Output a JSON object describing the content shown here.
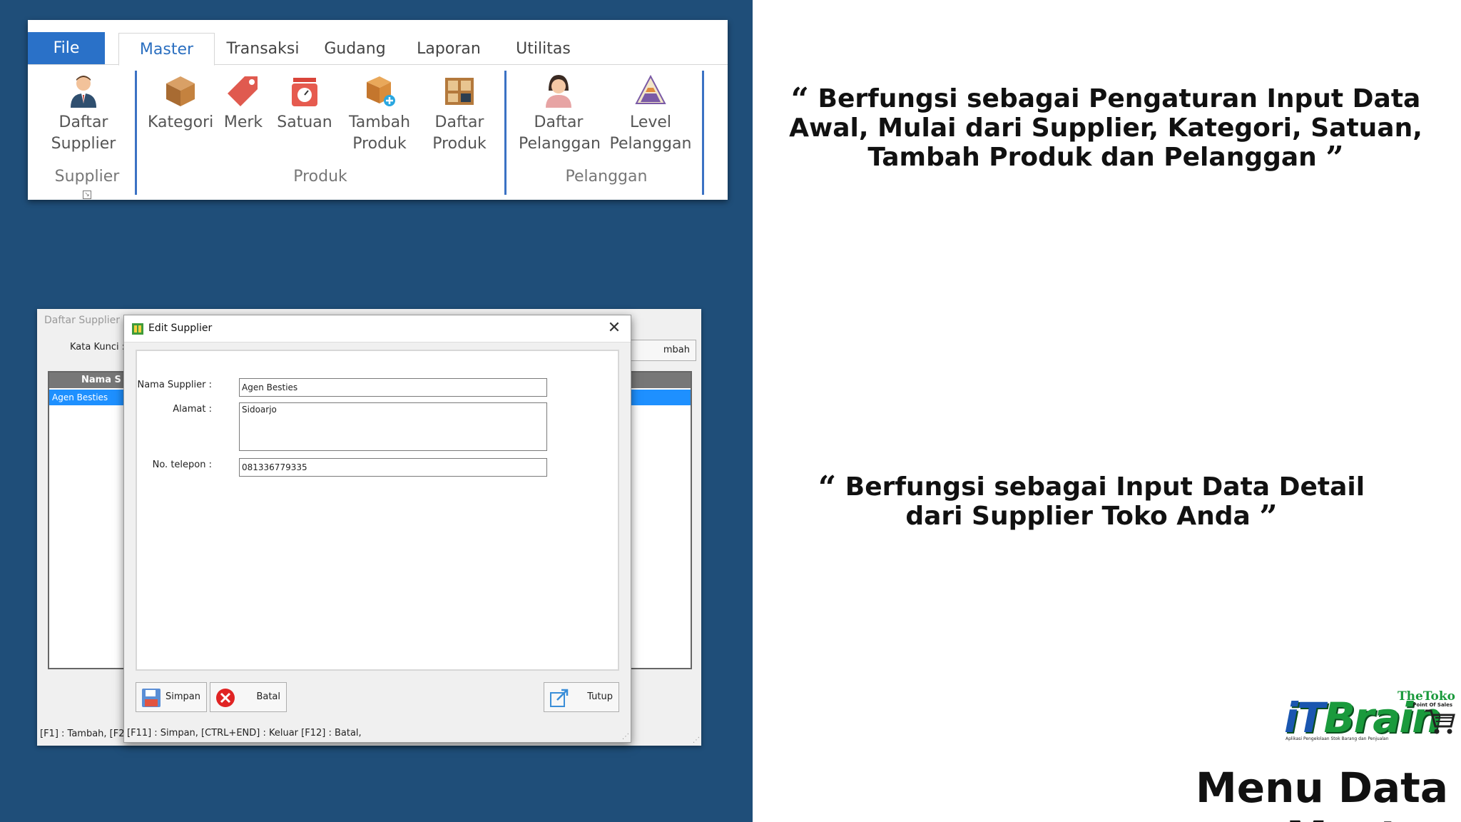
{
  "ribbon": {
    "tabs": [
      "File",
      "Master",
      "Transaksi",
      "Gudang",
      "Laporan",
      "Utilitas"
    ],
    "buttons": {
      "daftar_supplier": "Daftar\nSupplier",
      "kategori": "Kategori",
      "merk": "Merk",
      "satuan": "Satuan",
      "tambah_produk": "Tambah\nProduk",
      "daftar_produk": "Daftar\nProduk",
      "daftar_pelanggan": "Daftar\nPelanggan",
      "level_pelanggan": "Level\nPelanggan"
    },
    "groups": {
      "supplier": "Supplier",
      "produk": "Produk",
      "pelanggan": "Pelanggan"
    }
  },
  "daftar_supplier": {
    "title": "Daftar Supplier",
    "kata_kunci_label": "Kata Kunci :",
    "tambah_button": "mbah",
    "column_header": "Nama S",
    "rows": [
      "Agen Besties"
    ],
    "status": "[F1] : Tambah,    [F2"
  },
  "edit_supplier": {
    "title": "Edit Supplier",
    "close": "✕",
    "fields": {
      "nama_label": "Nama Supplier :",
      "nama_value": "Agen Besties",
      "alamat_label": "Alamat :",
      "alamat_value": "Sidoarjo",
      "telepon_label": "No. telepon :",
      "telepon_value": "081336779335"
    },
    "buttons": {
      "simpan": "Simpan",
      "batal": "Batal",
      "tutup": "Tutup"
    },
    "status": "[F11] : Simpan,    [CTRL+END] : Keluar    [F12] : Batal,"
  },
  "captions": {
    "caption1": "Berfungsi sebagai Pengaturan Input Data Awal, Mulai dari Supplier, Kategori, Satuan, Tambah Produk dan Pelanggan",
    "caption2": "Berfungsi sebagai Input Data Detail dari Supplier Toko Anda",
    "open_quote": "“",
    "close_quote": "”"
  },
  "slide_title": "Menu Data Master",
  "logo": {
    "it": "iT",
    "brain": "Brain",
    "thetoko": "TheToko",
    "pos": "Point Of Sales",
    "tagline": "Aplikasi Pengelolaan Stok Barang dan Penjualan"
  },
  "colors": {
    "left_background": "#1f4e79",
    "ribbon_accent": "#2a71c8",
    "selection": "#1e90ff",
    "logo_green": "#1a9a3c",
    "logo_blue": "#1a56b0"
  }
}
